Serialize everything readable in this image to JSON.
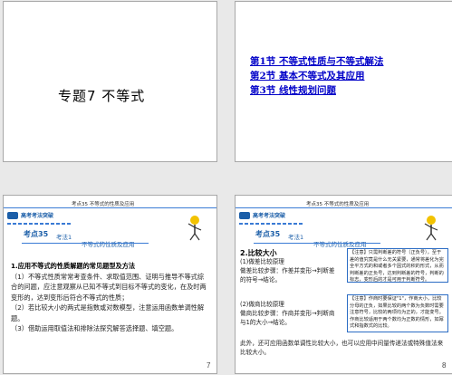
{
  "slides": [
    {
      "title": "专题7  不等式",
      "number": "1"
    },
    {
      "links": [
        "第1节  不等式性质与不等式解法",
        "第2节  基本不等式及其应用",
        "第3节  线性规划问题"
      ],
      "number": "2"
    },
    {
      "header": "考点35  不等式的性质及应用",
      "logo": "高考考法突破",
      "tag": "考点35",
      "subtag": "考法1",
      "subtag2": "不等式的性质及应用",
      "heading": "1.应用不等式的性质解题的常见题型及方法",
      "p1": "（1）不等式性质常常考查条件、求取值范围、证明与推导不等式综合的问题，应注意观察从已知不等式到目标不等式的变化，在及时两变形的，达到变形后符合不等式的性质；",
      "p2": "（2）若比较大小的两式是指数或对数模型，注意运用函数单调性解题。",
      "p3": "（3）借助运用取值法和排除法探究解答选择题、填空题。",
      "number": "7"
    },
    {
      "header": "考点35  不等式的性质及应用",
      "logo": "高考考法突破",
      "tag": "考点35",
      "subtag": "考法1",
      "subtag2": "不等式的性质及应用",
      "sec_title": "2.比较大小",
      "left1": "(1)做差比较原理\n做差比较步骤：作差并变形→判断差的符号→结论。",
      "box1": "【注意】只需判断差的符号（正负号），至于差的值究竟是什么无关紧要，通常将差化为完全平方式的和或者多个因式的积的形式，从而判断差的正负号，达到判断差的符号，判断的标志，变形后的才是可用于判断符号。",
      "left2": "(2)做商比较原理\n做商比较步骤：作商并变形→判断商与1的大小→结论。",
      "box2": "【注意】作商时要保证\"1\"，作商大小，比较分母的正负，如果比较的两个数为负数时需要注意符号，比较的两项均为正的，才能变号。作商比较适用于两个数均为正数的情形，如幂式和指数式的比较。",
      "footer": "此外，还可应用函数单调性比较大小，也可以应用中间量传递法或特殊值法来比较大小。",
      "number": "8"
    }
  ]
}
